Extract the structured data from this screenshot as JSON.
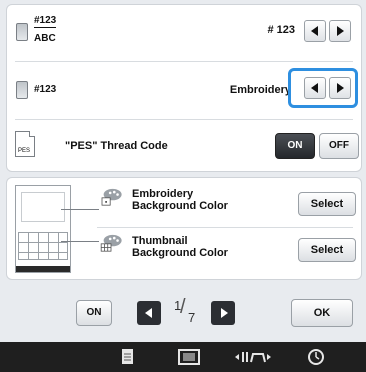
{
  "settings": {
    "row1": {
      "label_top": "#123",
      "label_bottom": "ABC",
      "value": "# 123"
    },
    "row2": {
      "label": "#123",
      "value": "Embroidery"
    },
    "row3": {
      "icon_text": "PES",
      "label": "\"PES\" Thread Code",
      "on_label": "ON",
      "off_label": "OFF"
    }
  },
  "background": {
    "embroidery": {
      "line1": "Embroidery",
      "line2": "Background Color",
      "button": "Select"
    },
    "thumbnail": {
      "line1": "Thumbnail",
      "line2": "Background Color",
      "button": "Select"
    }
  },
  "pager": {
    "on_label": "ON",
    "page_current": "1",
    "page_total": "7",
    "ok_label": "OK"
  },
  "icons": {
    "prev": "left-arrow-icon",
    "next": "right-arrow-icon",
    "bottom": [
      "page-icon",
      "hoop-icon",
      "needle-position-icon",
      "clock-icon"
    ]
  },
  "colors": {
    "highlight": "#2e8fe0",
    "bottom_bar": "#1f1f1f"
  }
}
